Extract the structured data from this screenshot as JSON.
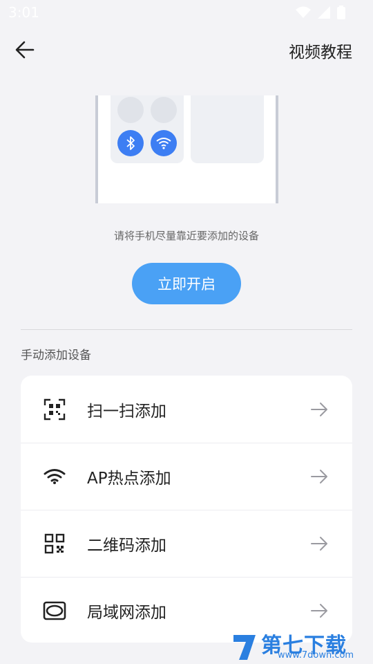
{
  "status_bar": {
    "time": "3:01"
  },
  "header": {
    "title_link": "视频教程"
  },
  "illustration": {
    "icons": [
      "bluetooth-icon",
      "wifi-icon"
    ]
  },
  "hint": "请将手机尽量靠近要添加的设备",
  "primary_button": "立即开启",
  "section_title": "手动添加设备",
  "options": [
    {
      "label": "扫一扫添加",
      "icon": "scan-qr-icon"
    },
    {
      "label": "AP热点添加",
      "icon": "wifi-icon"
    },
    {
      "label": "二维码添加",
      "icon": "qr-code-icon"
    },
    {
      "label": "局域网添加",
      "icon": "lan-icon"
    }
  ],
  "watermark": {
    "brand": "第七下载站",
    "url": "www.7down.com"
  },
  "colors": {
    "accent": "#4aa1f5",
    "icon_blue": "#3d7ef3",
    "background": "#f3f3f6"
  }
}
